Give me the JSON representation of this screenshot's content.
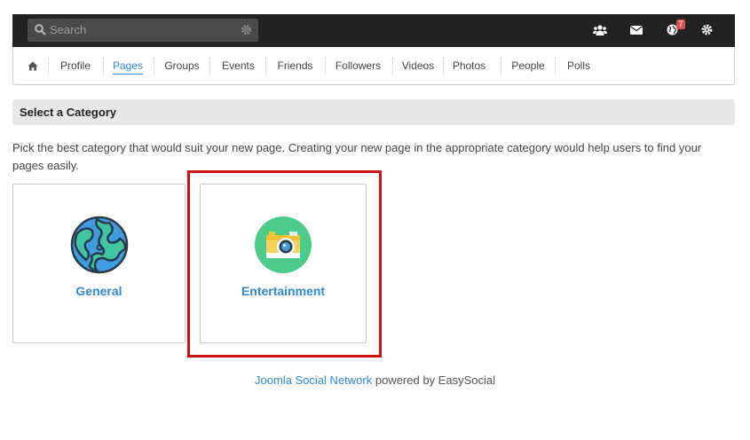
{
  "topbar": {
    "search_placeholder": "Search",
    "notification_badge": "7"
  },
  "nav": {
    "items": [
      {
        "label": "Profile"
      },
      {
        "label": "Pages"
      },
      {
        "label": "Groups"
      },
      {
        "label": "Events"
      },
      {
        "label": "Friends"
      },
      {
        "label": "Followers"
      },
      {
        "label": "Videos"
      },
      {
        "label": "Photos"
      },
      {
        "label": "People"
      },
      {
        "label": "Polls"
      }
    ],
    "active": "Pages"
  },
  "section": {
    "title": "Select a Category",
    "description": "Pick the best category that would suit your new page. Creating your new page in the appropriate category would help users to find your pages easily."
  },
  "categories": [
    {
      "label": "General",
      "icon": "globe-icon"
    },
    {
      "label": "Entertainment",
      "icon": "camera-icon"
    }
  ],
  "footer": {
    "link_text": "Joomla Social Network",
    "suffix_text": " powered by EasySocial"
  },
  "colors": {
    "accent": "#2c8ad6",
    "topbar": "#222222",
    "highlight": "#cc1111",
    "badge": "#d9534f"
  }
}
